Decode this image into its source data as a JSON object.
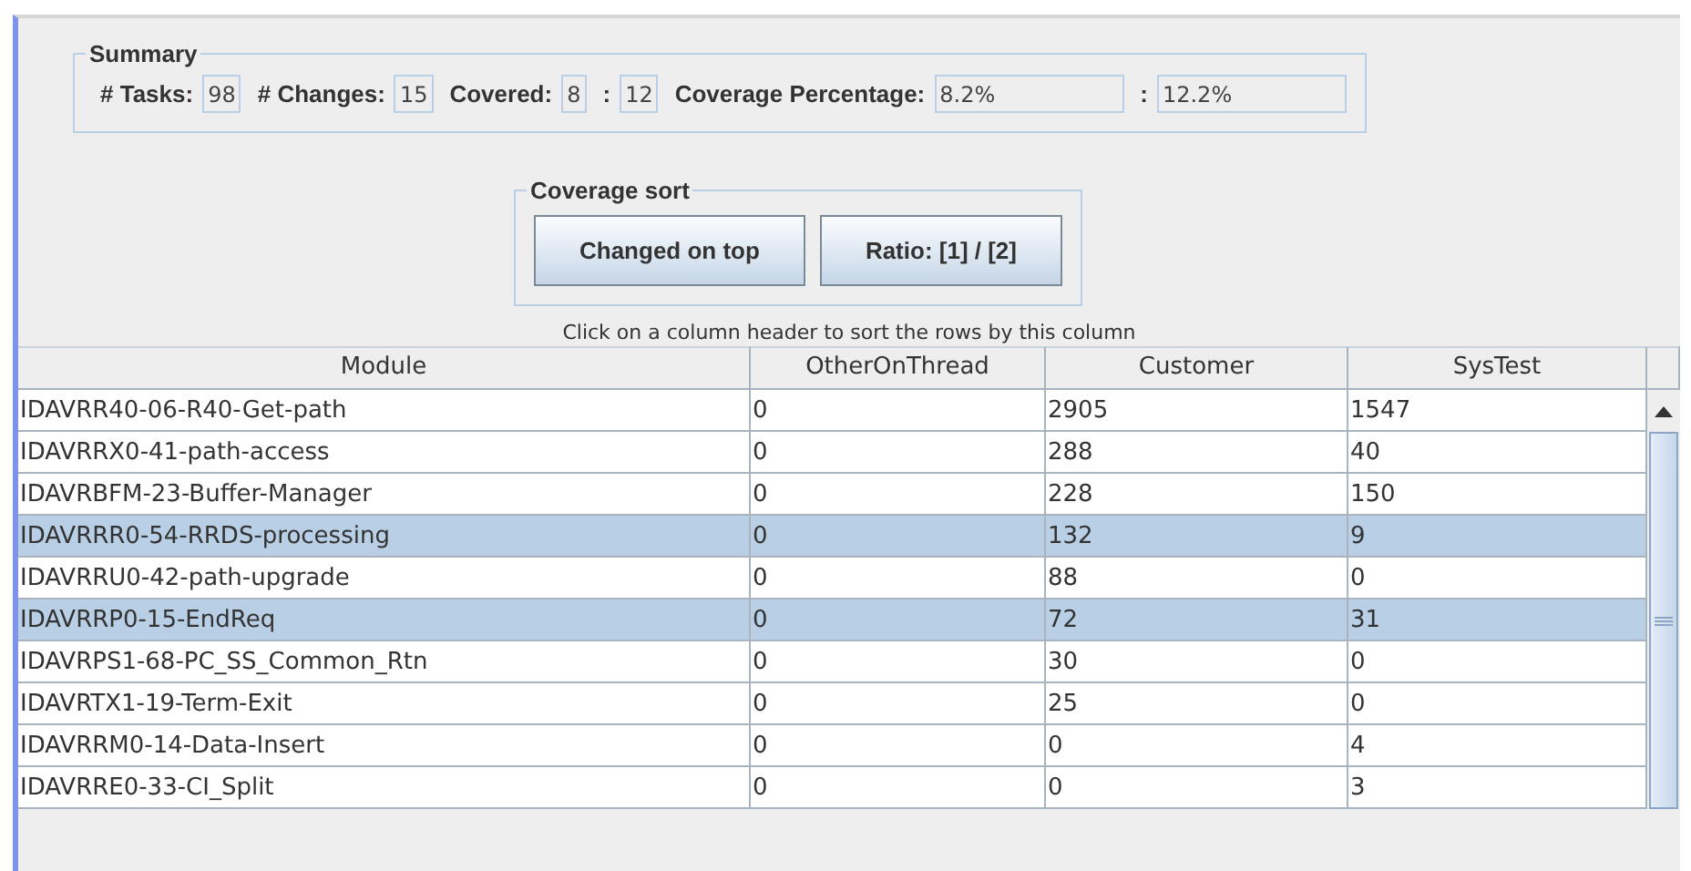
{
  "summary": {
    "title": "Summary",
    "fields": [
      {
        "label": "# Tasks:",
        "value": "98",
        "kind": "short"
      },
      {
        "label": "# Changes:",
        "value": "15",
        "kind": "short"
      },
      {
        "label": "Covered:",
        "value": "8",
        "kind": "short"
      },
      {
        "label": ":",
        "value": "12",
        "kind": "short"
      },
      {
        "label": "Coverage Percentage:",
        "value": "8.2%",
        "kind": "wide"
      },
      {
        "label": ":",
        "value": "12.2%",
        "kind": "wide"
      }
    ]
  },
  "coverage_sort": {
    "title": "Coverage sort",
    "buttons": [
      "Changed on top",
      "Ratio: [1] / [2]"
    ]
  },
  "hint": "Click on a column header to sort the rows by this column",
  "table": {
    "columns": [
      "Module",
      "OtherOnThread",
      "Customer",
      "SysTest"
    ],
    "rows": [
      {
        "cells": [
          "IDAVRR40-06-R40-Get-path",
          "0",
          "2905",
          "1547"
        ],
        "selected": false
      },
      {
        "cells": [
          "IDAVRRX0-41-path-access",
          "0",
          "288",
          "40"
        ],
        "selected": false
      },
      {
        "cells": [
          "IDAVRBFM-23-Buffer-Manager",
          "0",
          "228",
          "150"
        ],
        "selected": false
      },
      {
        "cells": [
          "IDAVRRR0-54-RRDS-processing",
          "0",
          "132",
          "9"
        ],
        "selected": true
      },
      {
        "cells": [
          "IDAVRRU0-42-path-upgrade",
          "0",
          "88",
          "0"
        ],
        "selected": false
      },
      {
        "cells": [
          "IDAVRRP0-15-EndReq",
          "0",
          "72",
          "31"
        ],
        "selected": true
      },
      {
        "cells": [
          "IDAVRPS1-68-PC_SS_Common_Rtn",
          "0",
          "30",
          "0"
        ],
        "selected": false
      },
      {
        "cells": [
          "IDAVRTX1-19-Term-Exit",
          "0",
          "25",
          "0"
        ],
        "selected": false
      },
      {
        "cells": [
          "IDAVRRM0-14-Data-Insert",
          "0",
          "0",
          "4"
        ],
        "selected": false
      },
      {
        "cells": [
          "IDAVRRE0-33-CI_Split",
          "0",
          "0",
          "3"
        ],
        "selected": false
      }
    ]
  }
}
